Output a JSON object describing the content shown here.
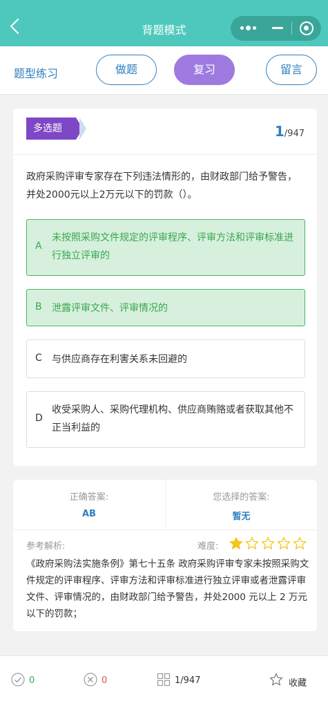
{
  "header": {
    "title": "背题模式"
  },
  "mode": {
    "label": "题型练习",
    "btn_do": "做题",
    "btn_review": "复习",
    "btn_message": "留言"
  },
  "question": {
    "type": "多选题",
    "current": "1",
    "total": "/947",
    "text": "政府采购评审专家存在下列违法情形的，由财政部门给予警告，并处2000元以上2万元以下的罚款（）。",
    "options": [
      {
        "letter": "A",
        "text": "未按照采购文件规定的评审程序、评审方法和评审标准进行独立评审的",
        "selected": true
      },
      {
        "letter": "B",
        "text": "泄露评审文件、评审情况的",
        "selected": true
      },
      {
        "letter": "C",
        "text": "与供应商存在利害关系未回避的",
        "selected": false
      },
      {
        "letter": "D",
        "text": "收受采购人、采购代理机构、供应商贿赂或者获取其他不正当利益的",
        "selected": false
      }
    ]
  },
  "answer": {
    "correct_label": "正确答案:",
    "correct_value": "AB",
    "chosen_label": "您选择的答案:",
    "chosen_value": "暂无",
    "analysis_label": "参考解析:",
    "difficulty_label": "难度:",
    "difficulty": 1,
    "difficulty_max": 5,
    "analysis": "《政府采购法实施条例》第七十五条 政府采购评审专家未按照采购文件规定的评审程序、评审方法和评审标准进行独立评审或者泄露评审文件、评审情况的，由财政部门给予警告，并处2000 元以上 2 万元以下的罚款；"
  },
  "bottom": {
    "correct_count": "0",
    "wrong_count": "0",
    "progress": "1/947",
    "favorite_label": "收藏"
  },
  "colors": {
    "header": "#4ec8bd",
    "accent_blue": "#2d7fc1",
    "review_purple": "#9e7ae0",
    "badge_purple": "#7e47c5",
    "selected_bg": "#d6f0dd",
    "selected_text": "#3aa64f",
    "star": "#f5c518"
  }
}
